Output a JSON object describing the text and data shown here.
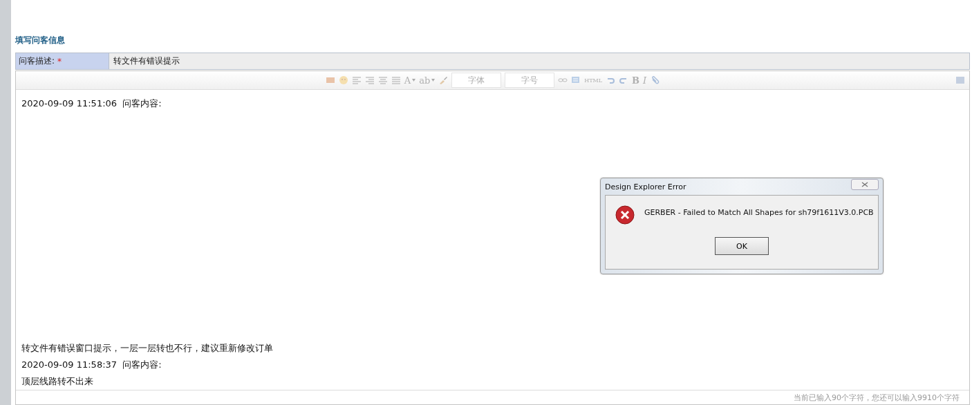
{
  "section_title": "填写问客信息",
  "description_field": {
    "label": "问客描述:",
    "required_mark": "*",
    "value": "转文件有错误提示"
  },
  "toolbar": {
    "items": [
      {
        "kind": "image"
      },
      {
        "kind": "emoji"
      },
      {
        "kind": "alignleft"
      },
      {
        "kind": "alignright"
      },
      {
        "kind": "aligncenter"
      },
      {
        "kind": "justify"
      },
      {
        "kind": "text",
        "label": "A",
        "dropdown": true
      },
      {
        "kind": "text",
        "label": "ab",
        "dropdown": true
      },
      {
        "kind": "brush"
      },
      {
        "kind": "select",
        "placeholder": "字体"
      },
      {
        "kind": "select",
        "placeholder": "字号"
      },
      {
        "kind": "link"
      },
      {
        "kind": "picture"
      },
      {
        "kind": "text",
        "label": "HTML",
        "dropdown": false
      },
      {
        "kind": "undo"
      },
      {
        "kind": "redo"
      },
      {
        "kind": "bold",
        "label": "B"
      },
      {
        "kind": "italic",
        "label": "I"
      },
      {
        "kind": "attach"
      }
    ],
    "right_item": {
      "kind": "fullscreen"
    }
  },
  "content": [
    {
      "kind": "line",
      "text": "2020-09-09 11:51:06  问客内容:"
    },
    {
      "kind": "dialog",
      "title": "Design Explorer Error",
      "message": "GERBER - Failed to Match All Shapes for sh79f1611V3.0.PCB",
      "button": "OK"
    },
    {
      "kind": "line",
      "text": "转文件有错误窗口提示，一层一层转也不行，建议重新修改订单"
    },
    {
      "kind": "line",
      "text": "2020-09-09 11:58:37  问客内容:"
    },
    {
      "kind": "line",
      "text": "顶层线路转不出来"
    }
  ],
  "counter": "当前已输入90个字符，您还可以输入9910个字符"
}
